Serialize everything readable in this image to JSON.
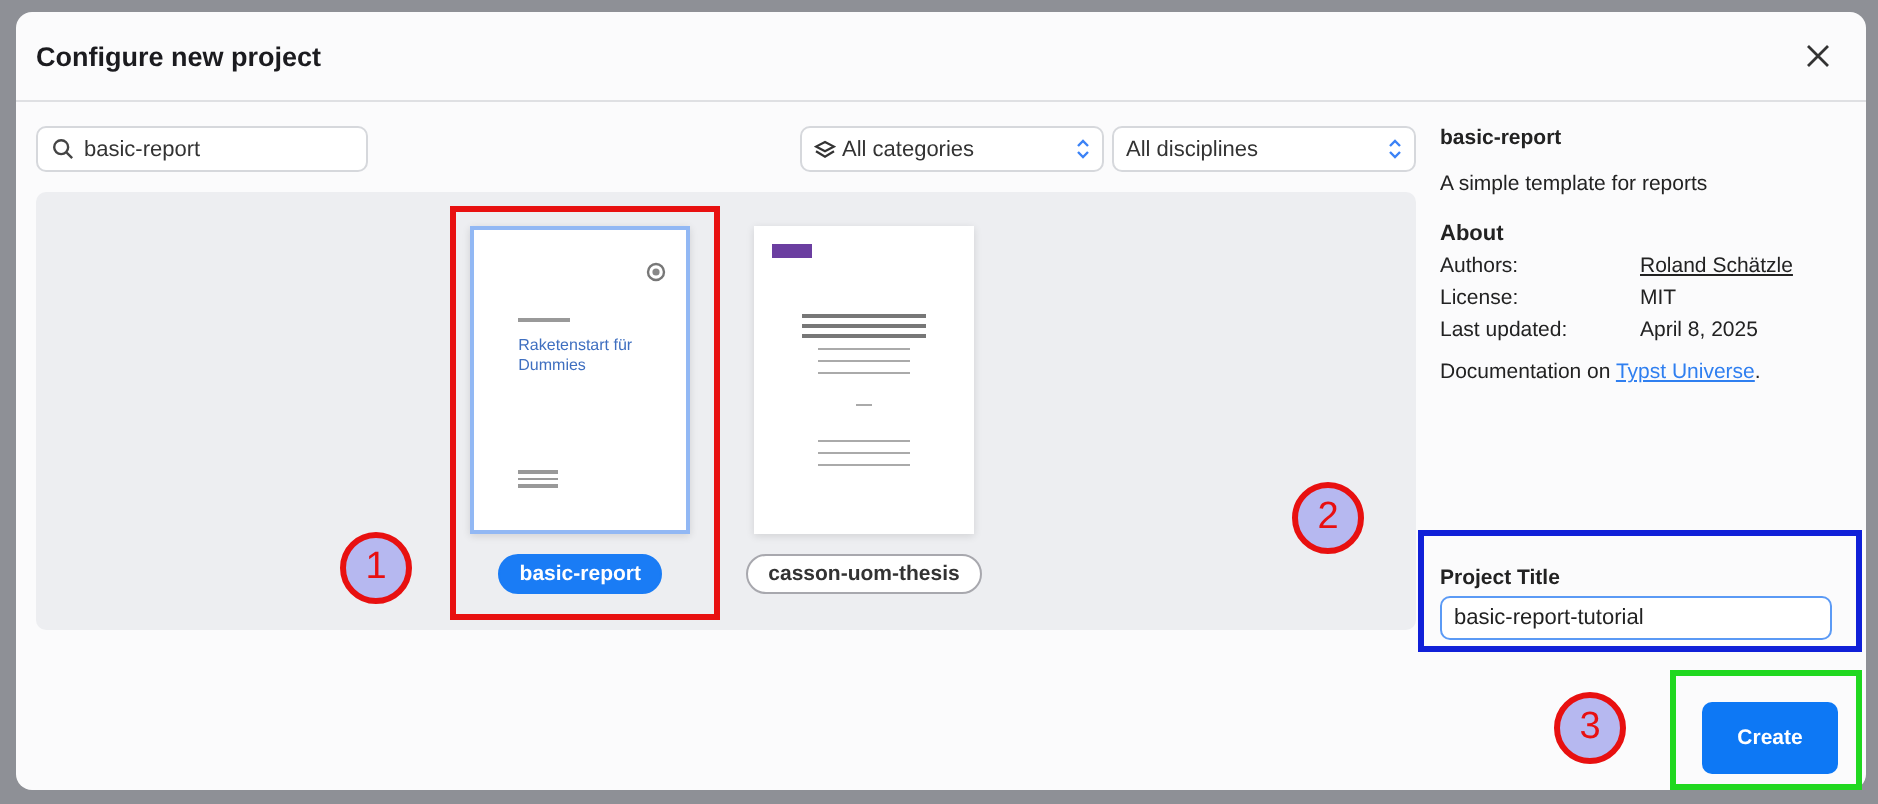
{
  "dialog": {
    "title": "Configure new project",
    "search": {
      "value": "basic-report"
    },
    "filters": [
      {
        "value": "All categories",
        "kind": "with-icon"
      },
      {
        "value": "All disciplines",
        "kind": "plain"
      }
    ],
    "templates": [
      {
        "name": "basic-report",
        "selected": true,
        "kind": "report",
        "cover_title": "Raketenstart für Dummies"
      },
      {
        "name": "casson-uom-thesis",
        "selected": false,
        "kind": "thesis"
      }
    ],
    "details": {
      "name": "basic-report",
      "description": "A simple template for reports",
      "about_heading": "About",
      "fields": [
        {
          "label": "Authors:",
          "value": "Roland Schätzle",
          "kind": "link"
        },
        {
          "label": "License:",
          "value": "MIT",
          "kind": "text"
        },
        {
          "label": "Last updated:",
          "value": "April 8, 2025",
          "kind": "text"
        }
      ],
      "documentation": "Documentation on ",
      "documentation_link": "Typst Universe",
      "documentation_end": "."
    },
    "project_title": {
      "label": "Project Title",
      "value": "basic-report-tutorial"
    },
    "create_button": "Create"
  },
  "annotations": [
    {
      "label": "1",
      "color": "#e81010"
    },
    {
      "label": "2",
      "color": "#e81010"
    },
    {
      "label": "3",
      "color": "#e81010"
    }
  ],
  "highlights": [
    {
      "color": "#e81010"
    },
    {
      "color": "#1020d8"
    },
    {
      "color": "#20d820"
    }
  ]
}
